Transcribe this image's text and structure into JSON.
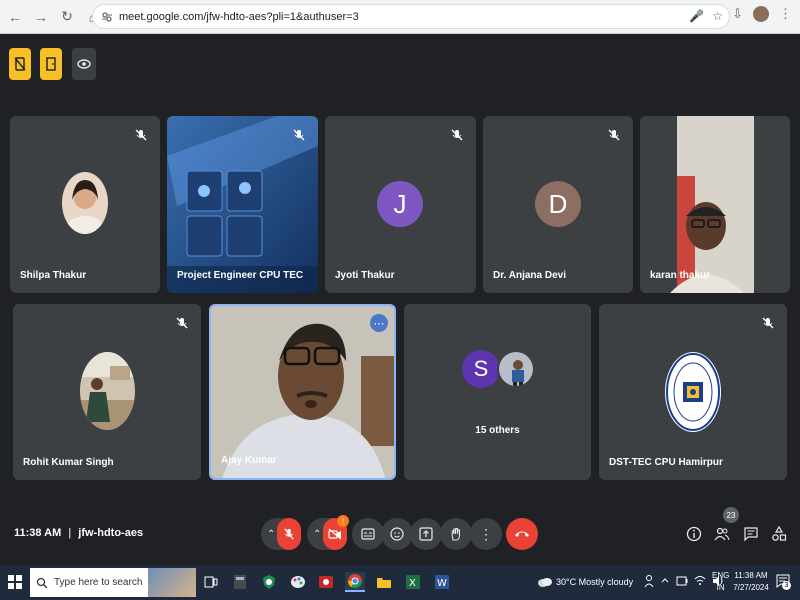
{
  "browser": {
    "url": "meet.google.com/jfw-hdto-aes?pli=1&authuser=3"
  },
  "tiles": [
    {
      "name": "Shilpa Thakur"
    },
    {
      "name": "Project Engineer CPU TEC"
    },
    {
      "name": "Jyoti Thakur",
      "initial": "J",
      "color": "#7e57c2"
    },
    {
      "name": "Dr. Anjana Devi",
      "initial": "D",
      "color": "#8d6e63"
    },
    {
      "name": "karan thakur"
    },
    {
      "name": "Rohit Kumar Singh"
    },
    {
      "name": "Ajay Kumar"
    },
    {
      "name": "15 others",
      "initial": "S",
      "color": "#5e35b1"
    },
    {
      "name": "DST-TEC CPU Hamirpur"
    }
  ],
  "bottom": {
    "time": "11:38 AM",
    "separator": "|",
    "meeting_code": "jfw-hdto-aes",
    "camera_badge": "!",
    "people_count": "23"
  },
  "taskbar": {
    "search_placeholder": "Type here to search",
    "weather": "30°C  Mostly cloudy",
    "lang": "ENG",
    "region": "IN",
    "clock_time": "11:38 AM",
    "clock_date": "7/27/2024",
    "notification_count": "3"
  },
  "colors": {
    "meet_bg": "#202124",
    "tile_bg": "#3c4043",
    "end_call_red": "#ea4335",
    "active_speaker_border": "#8ab4f8"
  }
}
